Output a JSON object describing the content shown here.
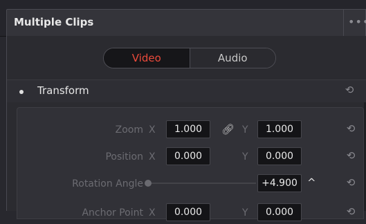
{
  "header": {
    "title": "Multiple Clips",
    "more_icon": "more-dots-icon"
  },
  "tabs": [
    {
      "label": "Video",
      "active": true
    },
    {
      "label": "Audio",
      "active": false
    }
  ],
  "colors": {
    "accent": "#ec4a3b",
    "panel": "#2b2b30",
    "field_bg": "#141417"
  },
  "section": {
    "title": "Transform",
    "reset_icon": "reset-icon"
  },
  "rows": {
    "zoom": {
      "label": "Zoom",
      "x_axis": "X",
      "x_value": "1.000",
      "y_axis": "Y",
      "y_value": "1.000",
      "link_icon": "link-icon"
    },
    "position": {
      "label": "Position",
      "x_axis": "X",
      "x_value": "0.000",
      "y_axis": "Y",
      "y_value": "0.000"
    },
    "rotation": {
      "label": "Rotation Angle",
      "value": "+4.900"
    },
    "anchor": {
      "label": "Anchor Point",
      "x_axis": "X",
      "x_value": "0.000",
      "y_axis": "Y",
      "y_value": "0.000"
    }
  }
}
